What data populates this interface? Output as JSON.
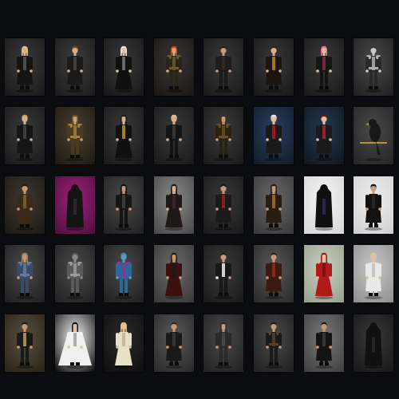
{
  "gallery": {
    "background": "#0b0c10",
    "rows": [
      [
        {
          "bg": [
            "#3a3a3a",
            "#1a1a1a"
          ],
          "outfit": "#141414",
          "accent": "#555555",
          "hair": "#d9c08a",
          "skin": "#d8b090",
          "style": "coat"
        },
        {
          "bg": [
            "#3c3c3c",
            "#1c1c1c"
          ],
          "outfit": "#1a1a1a",
          "accent": "#444444",
          "hair": "#6b4a2a",
          "skin": "#d8b090",
          "style": "coat"
        },
        {
          "bg": [
            "#3a3a3a",
            "#181818"
          ],
          "outfit": "#101010",
          "accent": "#777777",
          "hair": "#e6e6e6",
          "skin": "#e0c0a0",
          "style": "dress"
        },
        {
          "bg": [
            "#3a3632",
            "#1a1816"
          ],
          "outfit": "#2a2418",
          "accent": "#6a5a2a",
          "hair": "#c04a1a",
          "skin": "#d8a880",
          "style": "armor"
        },
        {
          "bg": [
            "#3a3a3a",
            "#1a1a1a"
          ],
          "outfit": "#1c1c1c",
          "accent": "#3a2a1a",
          "hair": "#2a1a10",
          "skin": "#c89878",
          "style": "plain"
        },
        {
          "bg": [
            "#3a3a3a",
            "#181818"
          ],
          "outfit": "#1c1410",
          "accent": "#c08020",
          "hair": "#3a2010",
          "skin": "#d8b090",
          "style": "coat"
        },
        {
          "bg": [
            "#3a3a3a",
            "#1a1a1a"
          ],
          "outfit": "#151515",
          "accent": "#8a2a4a",
          "hair": "#e070a0",
          "skin": "#e0c0a0",
          "style": "plain"
        },
        {
          "bg": [
            "#4a4a4a",
            "#202020"
          ],
          "outfit": "#2a2a2a",
          "accent": "#b0b0b0",
          "hair": "#303030",
          "skin": "#c8c8c8",
          "style": "armor"
        }
      ],
      [
        {
          "bg": [
            "#3a3a3a",
            "#1a1a1a"
          ],
          "outfit": "#151515",
          "accent": "#444444",
          "hair": "#c0a070",
          "skin": "#d8b090",
          "style": "coat"
        },
        {
          "bg": [
            "#4a4032",
            "#1e1a14"
          ],
          "outfit": "#4a3a20",
          "accent": "#a08040",
          "hair": "#6a5028",
          "skin": "#c8a070",
          "style": "armor"
        },
        {
          "bg": [
            "#3a3a3a",
            "#1a1a1a"
          ],
          "outfit": "#101010",
          "accent": "#c09020",
          "hair": "#1a1a1a",
          "skin": "#d8b090",
          "style": "dress"
        },
        {
          "bg": [
            "#3a3a3a",
            "#1a1a1a"
          ],
          "outfit": "#141414",
          "accent": "#3a3a3a",
          "hair": "#d8c090",
          "skin": "#d8b090",
          "style": "plain"
        },
        {
          "bg": [
            "#3c3c3c",
            "#1a1a1a"
          ],
          "outfit": "#2a2010",
          "accent": "#6a5020",
          "hair": "#3a2a18",
          "skin": "#c89878",
          "style": "armor"
        },
        {
          "bg": [
            "#2a4060",
            "#121c2a"
          ],
          "outfit": "#1a1a1a",
          "accent": "#b01a1a",
          "hair": "#e8e8e8",
          "skin": "#e0c0a0",
          "style": "coat"
        },
        {
          "bg": [
            "#243850",
            "#101820"
          ],
          "outfit": "#1a1a1a",
          "accent": "#b0203a",
          "hair": "#7a1010",
          "skin": "#e0c0a0",
          "style": "coat"
        },
        {
          "bg": [
            "#4a4a4a",
            "#252525"
          ],
          "outfit": "#181818",
          "accent": "#c09030",
          "hair": "#181818",
          "skin": "#181818",
          "style": "bird"
        }
      ],
      [
        {
          "bg": [
            "#403a30",
            "#1c1a16"
          ],
          "outfit": "#3a2a18",
          "accent": "#806030",
          "hair": "#2a1a10",
          "skin": "#c89878",
          "style": "coat"
        },
        {
          "bg": [
            "#a0207a",
            "#501040"
          ],
          "outfit": "#141414",
          "accent": "#303030",
          "hair": "#141414",
          "skin": "#141414",
          "style": "hood"
        },
        {
          "bg": [
            "#4a4a4a",
            "#222222"
          ],
          "outfit": "#151515",
          "accent": "#404040",
          "hair": "#101010",
          "skin": "#c89878",
          "style": "plain"
        },
        {
          "bg": [
            "#8a8a8a",
            "#4a4a4a"
          ],
          "outfit": "#201818",
          "accent": "#3a2a2a",
          "hair": "#1a1a1a",
          "skin": "#d8b090",
          "style": "dress"
        },
        {
          "bg": [
            "#3a3a3a",
            "#1a1a1a"
          ],
          "outfit": "#1a1a1a",
          "accent": "#9a2020",
          "hair": "#1a1a1a",
          "skin": "#c89878",
          "style": "coat"
        },
        {
          "bg": [
            "#6a6a6a",
            "#3a3a3a"
          ],
          "outfit": "#2a1c10",
          "accent": "#a07030",
          "hair": "#2a1a10",
          "skin": "#c89878",
          "style": "coat"
        },
        {
          "bg": [
            "#f4f4f4",
            "#d8d8d8"
          ],
          "outfit": "#101010",
          "accent": "#3a2a60",
          "hair": "#101010",
          "skin": "#d8b090",
          "style": "hood"
        },
        {
          "bg": [
            "#f0f0f0",
            "#d0d0d0"
          ],
          "outfit": "#121212",
          "accent": "#2a2a2a",
          "hair": "#101010",
          "skin": "#c8a080",
          "style": "coat"
        }
      ],
      [
        {
          "bg": [
            "#4a4a4a",
            "#202020"
          ],
          "outfit": "#3a4a6a",
          "accent": "#6a7a9a",
          "hair": "#a08060",
          "skin": "#c89878",
          "style": "armor"
        },
        {
          "bg": [
            "#4a4a4a",
            "#222222"
          ],
          "outfit": "#5a5a5a",
          "accent": "#9a9a9a",
          "hair": "#5a5a5a",
          "skin": "#8a8a8a",
          "style": "armor"
        },
        {
          "bg": [
            "#4a4a4a",
            "#202020"
          ],
          "outfit": "#2a6a9a",
          "accent": "#7a3a9a",
          "hair": "#3a8ab0",
          "skin": "#5a9ac0",
          "style": "armor"
        },
        {
          "bg": [
            "#6a6a6a",
            "#3a3a3a"
          ],
          "outfit": "#3a1010",
          "accent": "#1a1a1a",
          "hair": "#2a1a10",
          "skin": "#c89878",
          "style": "dress"
        },
        {
          "bg": [
            "#3a3a3a",
            "#1a1a1a"
          ],
          "outfit": "#181818",
          "accent": "#f0f0f0",
          "hair": "#2a1a10",
          "skin": "#c89878",
          "style": "plain"
        },
        {
          "bg": [
            "#5a5a5a",
            "#2a2a2a"
          ],
          "outfit": "#3a1a10",
          "accent": "#9a2a1a",
          "hair": "#3a2010",
          "skin": "#c89878",
          "style": "coat"
        },
        {
          "bg": [
            "#c8d0c0",
            "#98a090"
          ],
          "outfit": "#b01a1a",
          "accent": "#7a1010",
          "hair": "#9a1a1a",
          "skin": "#e0c0a0",
          "style": "dress"
        },
        {
          "bg": [
            "#c8c8c8",
            "#909090"
          ],
          "outfit": "#e8e8e8",
          "accent": "#c0c0c0",
          "hair": "#d8c8a0",
          "skin": "#e0c0a0",
          "style": "coat"
        }
      ],
      [
        {
          "bg": [
            "#5a5040",
            "#2a2418"
          ],
          "outfit": "#1a1a1a",
          "accent": "#c0a050",
          "hair": "#1a1a1a",
          "skin": "#c89878",
          "style": "plain"
        },
        {
          "bg": [
            "#f4f4f4",
            "#101010"
          ],
          "outfit": "#f0f0f0",
          "accent": "#a0a0a0",
          "hair": "#1a1a1a",
          "skin": "#e0c0a0",
          "style": "cape"
        },
        {
          "bg": [
            "#2a2a2a",
            "#101010"
          ],
          "outfit": "#e8e0c8",
          "accent": "#c0b090",
          "hair": "#e0c080",
          "skin": "#e0c0a0",
          "style": "dress"
        },
        {
          "bg": [
            "#5a5a5a",
            "#2a2a2a"
          ],
          "outfit": "#1a1a1a",
          "accent": "#3a3a3a",
          "hair": "#2a2a2a",
          "skin": "#c89878",
          "style": "coat"
        },
        {
          "bg": [
            "#4a4a4a",
            "#222222"
          ],
          "outfit": "#2a2a2a",
          "accent": "#4a4a4a",
          "hair": "#2a2a2a",
          "skin": "#c89878",
          "style": "plain"
        },
        {
          "bg": [
            "#4a4a4a",
            "#202020"
          ],
          "outfit": "#1a1a1a",
          "accent": "#5a4030",
          "hair": "#1a1a1a",
          "skin": "#c89878",
          "style": "armor"
        },
        {
          "bg": [
            "#7a7a7a",
            "#404040"
          ],
          "outfit": "#141414",
          "accent": "#3a3a3a",
          "hair": "#1a1a1a",
          "skin": "#c89878",
          "style": "coat"
        },
        {
          "bg": [
            "#3a3a3a",
            "#181818"
          ],
          "outfit": "#101010",
          "accent": "#2a2a2a",
          "hair": "#101010",
          "skin": "#101010",
          "style": "hood"
        }
      ]
    ]
  }
}
